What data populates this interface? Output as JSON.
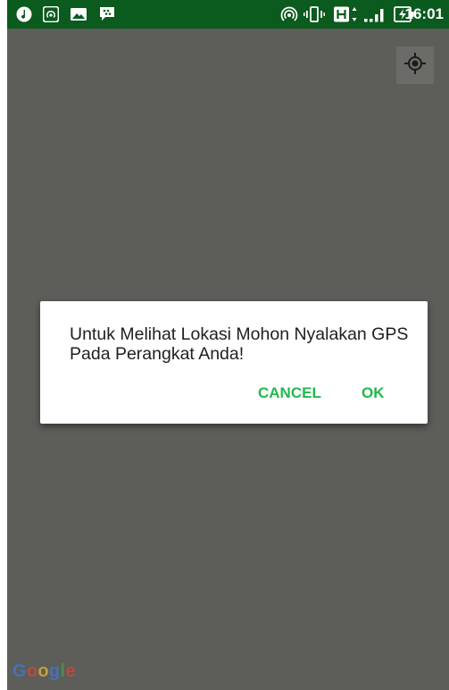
{
  "status_bar": {
    "time": "16:01",
    "left_icons": [
      "music-icon",
      "hotspot-icon",
      "image-icon",
      "bbm-icon"
    ],
    "right_icons": [
      "hotspot-icon",
      "vibrate-icon",
      "hspa-icon",
      "signal-icon",
      "battery-charging-icon"
    ]
  },
  "map": {
    "attribution": "Google",
    "locate_button_icon": "my-location-icon"
  },
  "dialog": {
    "message": "Untuk Melihat Lokasi Mohon Nyalakan GPS Pada Perangkat Anda!",
    "cancel_label": "CANCEL",
    "ok_label": "OK"
  },
  "colors": {
    "status_bar": "#0b5a1e",
    "map_background": "#5d5d59",
    "accent": "#22b84e"
  }
}
